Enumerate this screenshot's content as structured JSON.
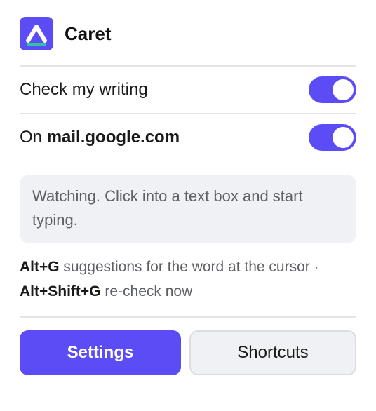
{
  "app": {
    "title": "Caret",
    "logo_icon": "caret-logo-icon",
    "accent_color": "#5b4cf5",
    "logo_stripe_color": "#2ec4a6"
  },
  "settings": {
    "check_writing": {
      "label": "Check my writing",
      "enabled": true
    },
    "site": {
      "prefix": "On ",
      "domain": "mail.google.com",
      "enabled": true
    }
  },
  "status": {
    "message": "Watching. Click into a text box and start typing."
  },
  "hints": {
    "suggest_key": "Alt+G",
    "suggest_text": " suggestions for the word at the cursor ·",
    "recheck_key": "Alt+Shift+G",
    "recheck_text": " re-check now"
  },
  "actions": {
    "settings_label": "Settings",
    "shortcuts_label": "Shortcuts"
  }
}
